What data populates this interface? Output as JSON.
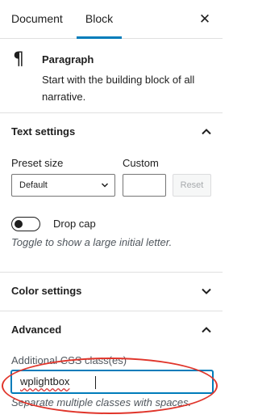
{
  "tabs": {
    "document": "Document",
    "block": "Block"
  },
  "close_icon": "close-icon",
  "block_card": {
    "icon": "¶",
    "title": "Paragraph",
    "description": "Start with the building block of all narrative."
  },
  "text_settings": {
    "title": "Text settings",
    "preset_label": "Preset size",
    "preset_value": "Default",
    "custom_label": "Custom",
    "custom_value": "",
    "reset_label": "Reset",
    "drop_cap_label": "Drop cap",
    "drop_cap_enabled": false,
    "drop_cap_help": "Toggle to show a large initial letter."
  },
  "color_settings": {
    "title": "Color settings"
  },
  "advanced": {
    "title": "Advanced",
    "css_label": "Additional CSS class(es)",
    "css_value": "wplightbox",
    "css_help": "Separate multiple classes with spaces."
  },
  "colors": {
    "accent": "#007cba",
    "annotation": "#e0352b",
    "spellcheck": "#d63638"
  }
}
